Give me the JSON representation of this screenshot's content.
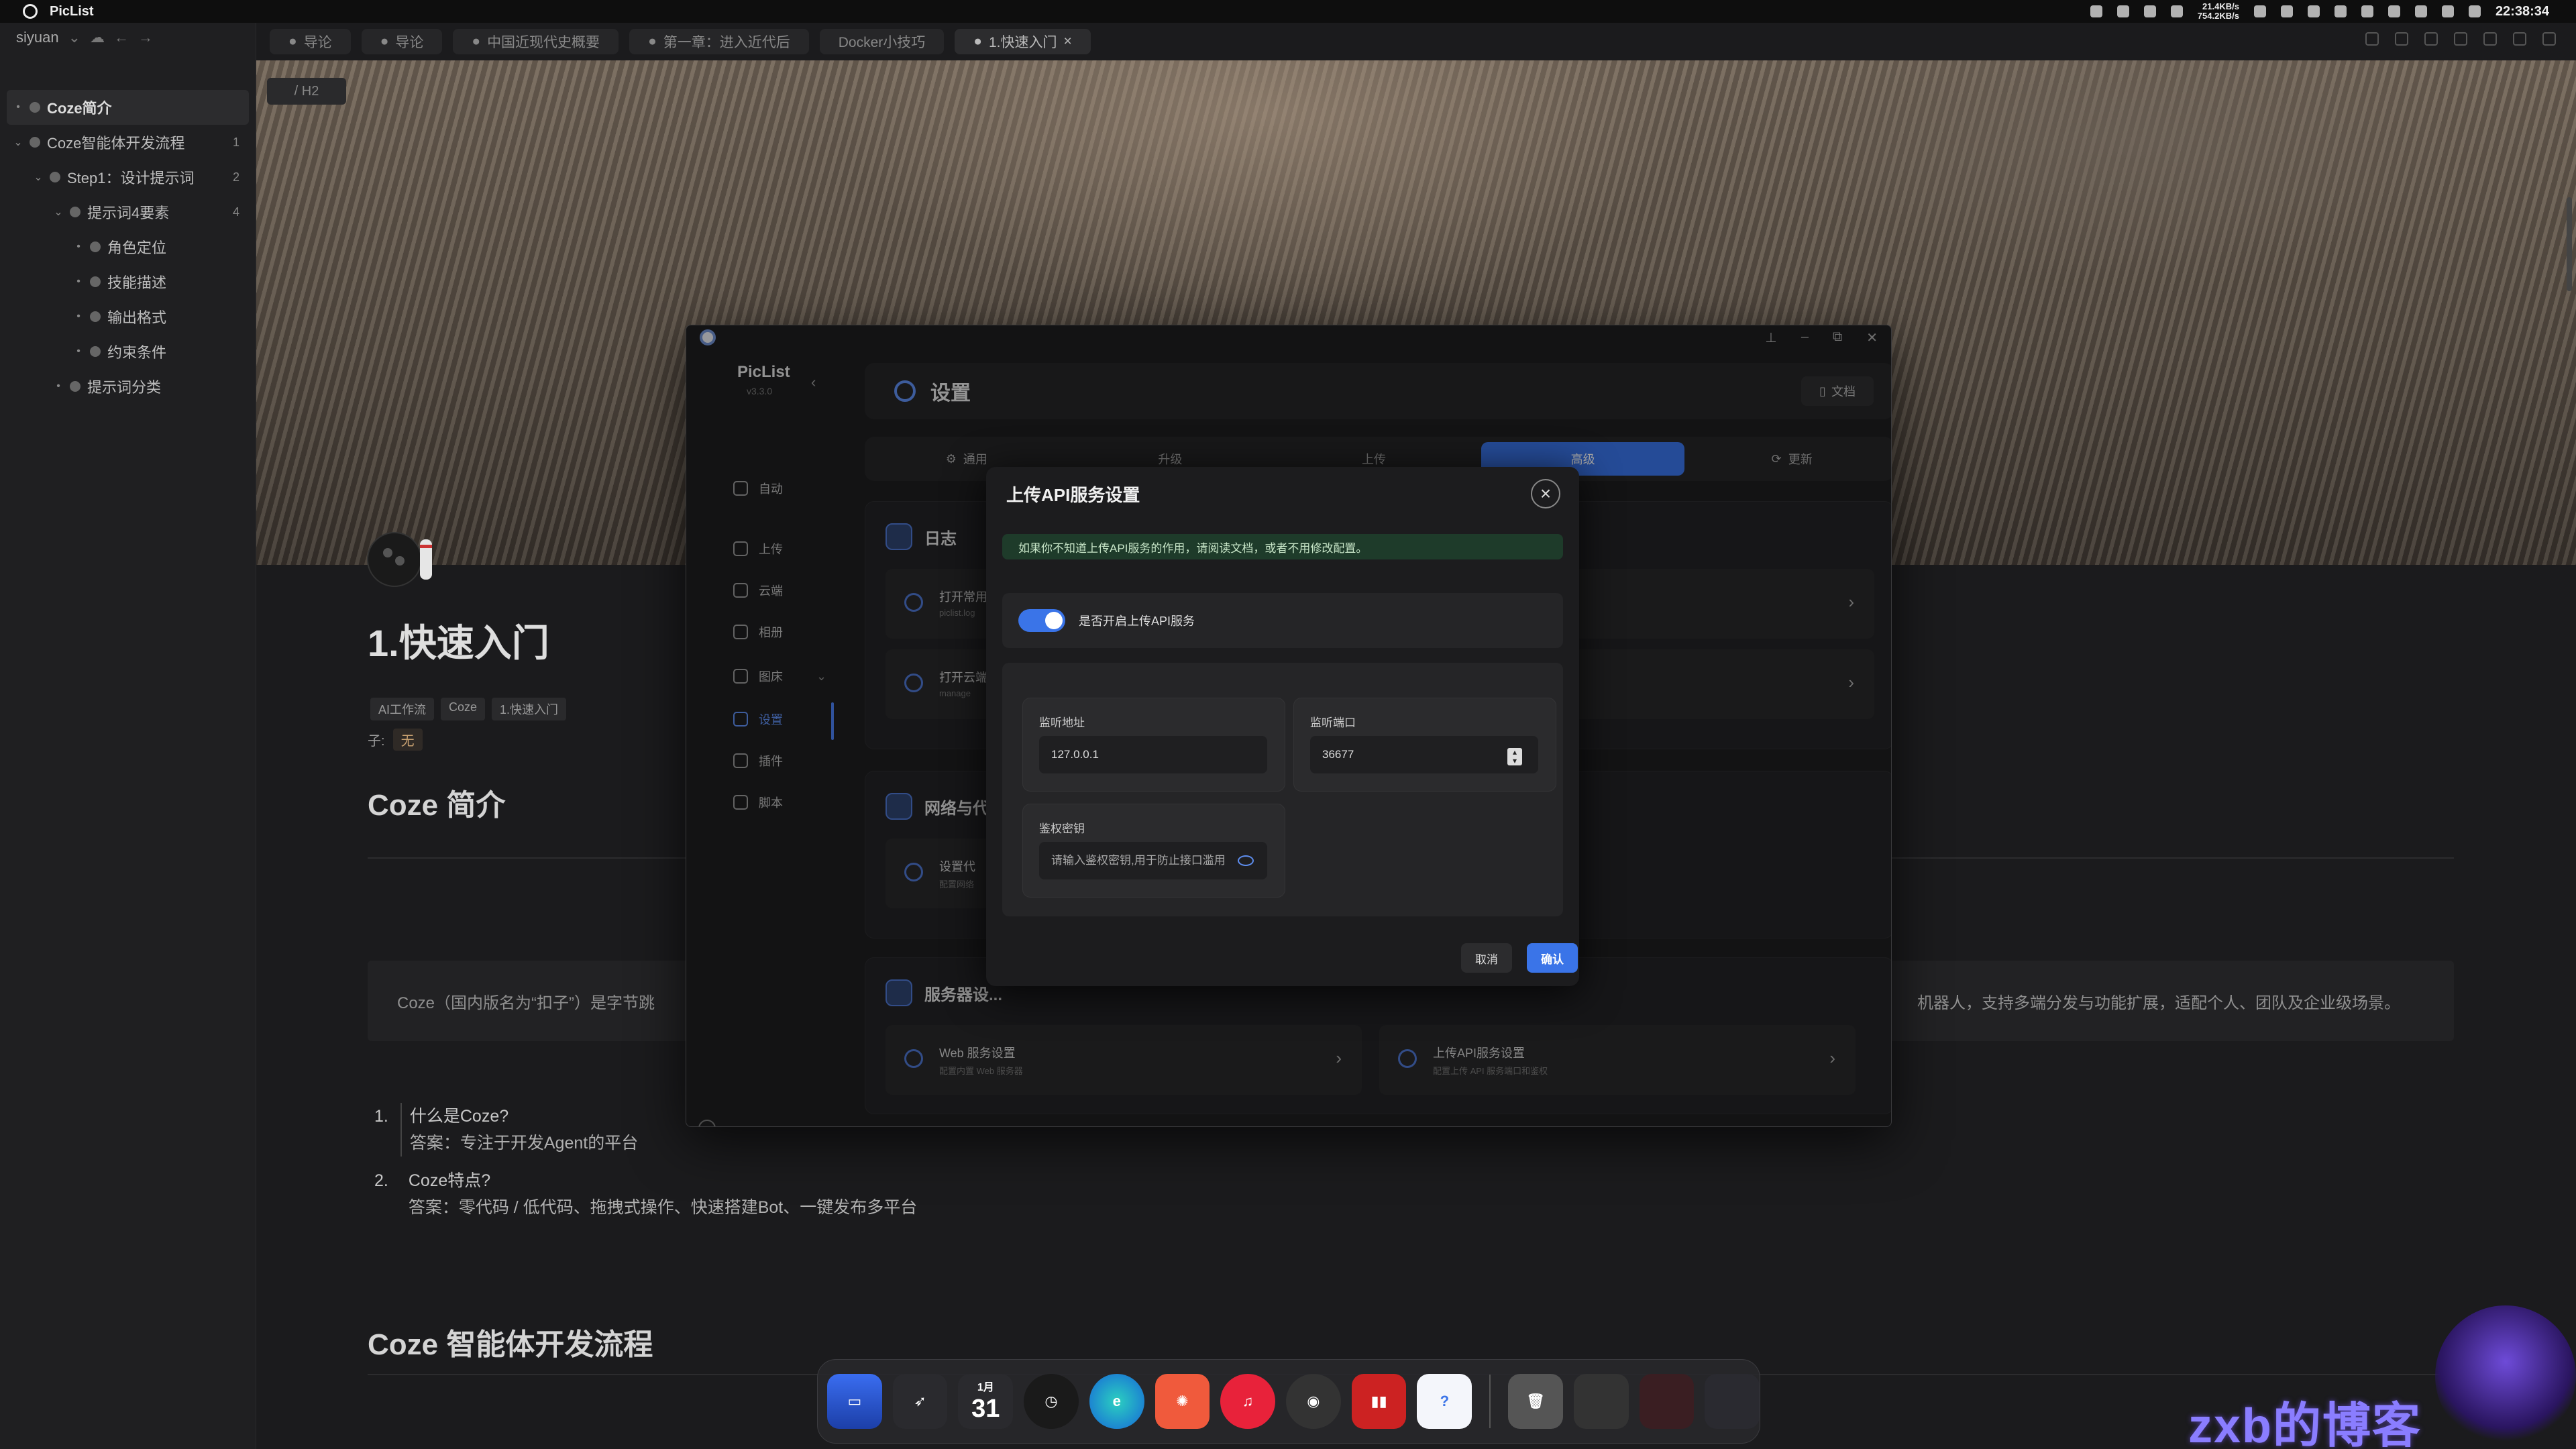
{
  "menubar": {
    "app_name": "PicList",
    "net_up": "21.4KB/s",
    "net_down": "754.2KB/s",
    "clock": "22:38:34"
  },
  "sidebar": {
    "workspace": "siyuan",
    "items": [
      {
        "label": "Coze简介",
        "count": ""
      },
      {
        "label": "Coze智能体开发流程",
        "count": "1"
      },
      {
        "label": "Step1：设计提示词",
        "count": "2"
      },
      {
        "label": "提示词4要素",
        "count": "4"
      },
      {
        "label": "角色定位",
        "count": ""
      },
      {
        "label": "技能描述",
        "count": ""
      },
      {
        "label": "输出格式",
        "count": ""
      },
      {
        "label": "约束条件",
        "count": ""
      },
      {
        "label": "提示词分类",
        "count": ""
      }
    ]
  },
  "editor": {
    "tabs": [
      "导论",
      "导论",
      "中国近现代史概要",
      "第一章：进入近代后",
      "Docker小技巧",
      "1.快速入门"
    ],
    "breadcrumb_btn": "/ H2",
    "doc_title": "1.快速入门",
    "crumbs": [
      "AI工作流",
      "Coze",
      "1.快速入门"
    ],
    "prop_label": "子:",
    "prop_value": "无",
    "h_intro": "Coze 简介",
    "quote_left": "Coze（国内版名为“扣子”）是字节跳",
    "quote_right": "机器人，支持多端分发与功能扩展，适配个人、团队及企业级场景。",
    "qa": [
      {
        "num": "1.",
        "q": "什么是Coze?",
        "a": "答案：专注于开发Agent的平台"
      },
      {
        "num": "2.",
        "q": "Coze特点?",
        "a": "答案：零代码 / 低代码、拖拽式操作、快速搭建Bot、一键发布多平台"
      }
    ],
    "h_flow": "Coze 智能体开发流程"
  },
  "piclist": {
    "brand": "PicList",
    "version": "v3.3.0",
    "nav": [
      "自动",
      "上传",
      "云端",
      "相册",
      "图床",
      "设置",
      "插件",
      "脚本"
    ],
    "header_title": "设置",
    "docs_label": "文档",
    "tabs": [
      "通用",
      "升级",
      "上传",
      "高级",
      "更新"
    ],
    "card_log_title": "日志",
    "row_log1_title": "打开常用",
    "row_log1_sub": "piclist.log",
    "row_log2_title": "打开云端",
    "row_log2_sub": "manage",
    "card_net_title": "网络与代",
    "row_net_title": "设置代",
    "row_net_sub": "配置网络",
    "card_server_title": "服务器设...",
    "row_web_title": "Web 服务设置",
    "row_web_sub": "配置内置 Web 服务器",
    "row_api_title": "上传API服务设置",
    "row_api_sub": "配置上传 API 服务端口和鉴权"
  },
  "dialog": {
    "title": "上传API服务设置",
    "notice": "如果你不知道上传API服务的作用，请阅读文档，或者不用修改配置。",
    "toggle_label": "是否开启上传API服务",
    "toggle_on": true,
    "host_label": "监听地址",
    "host_value": "127.0.0.1",
    "port_label": "监听端口",
    "port_value": "36677",
    "key_label": "鉴权密钥",
    "key_placeholder": "请输入鉴权密钥,用于防止接口滥用",
    "cancel": "取消",
    "confirm": "确认"
  },
  "dock": {
    "calendar_month": "1月",
    "calendar_day": "31"
  },
  "watermark": "zxb的博客",
  "colors": {
    "accent": "#3a74e8",
    "notice_bg": "#1e3b2a",
    "background": "#1b1b1d"
  }
}
